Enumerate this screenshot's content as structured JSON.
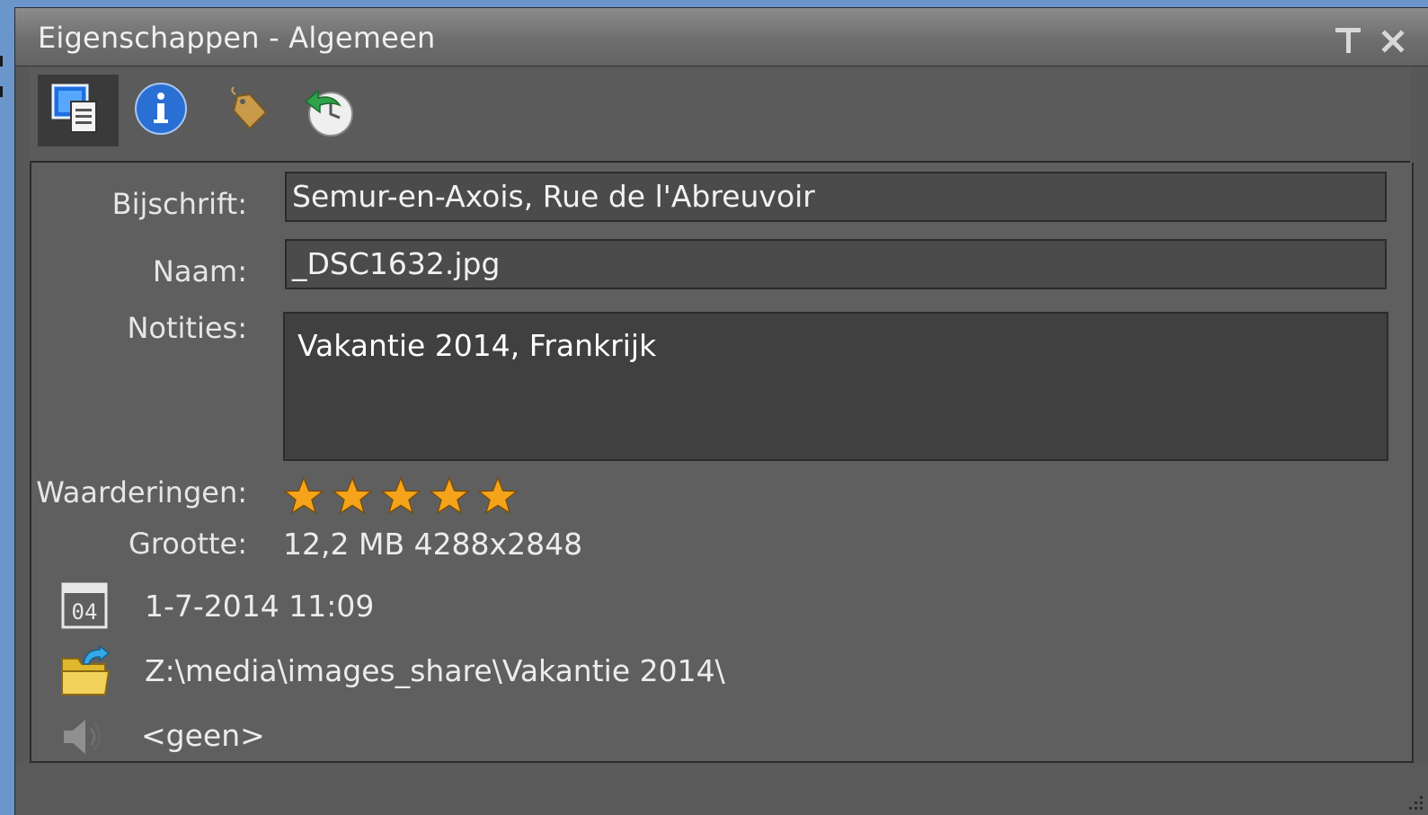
{
  "window": {
    "title": "Eigenschappen - Algemeen"
  },
  "toolbar": {
    "buttons": [
      {
        "name": "general-properties",
        "icon": "properties-document-icon",
        "active": true
      },
      {
        "name": "info",
        "icon": "info-icon",
        "active": false
      },
      {
        "name": "tags",
        "icon": "tag-icon",
        "active": false
      },
      {
        "name": "history",
        "icon": "history-clock-icon",
        "active": false
      }
    ]
  },
  "properties": {
    "caption_label": "Bijschrift:",
    "caption_value": "Semur-en-Axois, Rue de l'Abreuvoir",
    "name_label": "Naam:",
    "name_value": "_DSC1632.jpg",
    "notes_label": "Notities:",
    "notes_value": "Vakantie 2014, Frankrijk",
    "rating_label": "Waarderingen:",
    "rating_value": 5,
    "rating_max": 5,
    "size_label": "Grootte:",
    "size_value": "12,2 MB  4288x2848",
    "date_icon_text": "04",
    "date_value": "1-7-2014 11:09",
    "path_value": "Z:\\media\\images_share\\Vakantie 2014\\",
    "audio_value": "<geen>"
  },
  "colors": {
    "panel_bg": "#5f5f5f",
    "star": "#f5a31a",
    "desktop": "#6b96cc"
  }
}
